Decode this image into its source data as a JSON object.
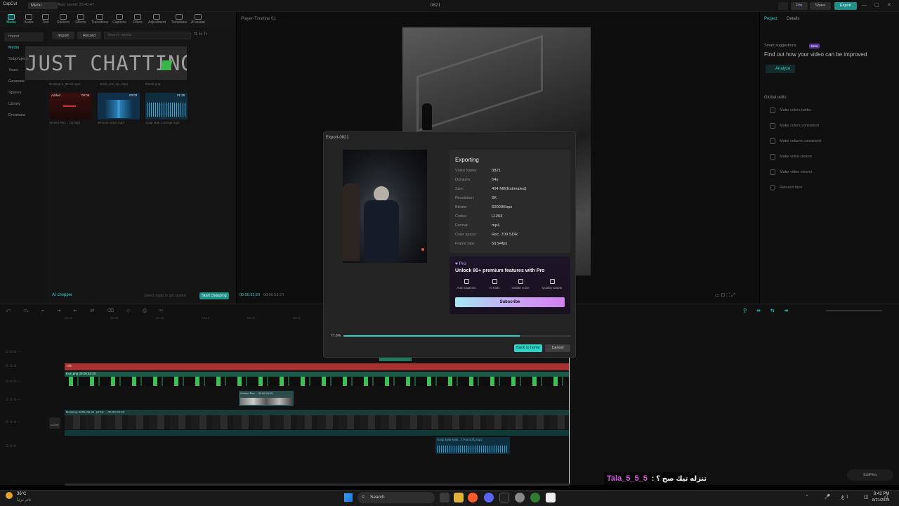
{
  "topbar": {
    "app_name": "CapCut",
    "menu_label": "Menu",
    "autosave": "Auto saved: 20:40:47",
    "window_title": "0821",
    "pro_label": "Pro",
    "share_label": "Share",
    "export_label": "Export"
  },
  "toolbar": {
    "tools": [
      "Media",
      "Audio",
      "Text",
      "Stickers",
      "Effects",
      "Transitions",
      "Captions",
      "Filters",
      "Adjustment",
      "Templates",
      "AI avatar"
    ]
  },
  "sidebar": {
    "items": [
      "Import",
      "Media",
      "Subprojects",
      "Yours",
      "Generate",
      "Spaces",
      "Library",
      "Dreamina"
    ]
  },
  "media": {
    "import_button": "Import",
    "record_button": "Record",
    "search_placeholder": "Search media",
    "overlay_text": "JUST CHATTING",
    "row1_captions": [
      "Desktop 2_08-52.mp4",
      "stock_xml_ep...mp3",
      "thumb.png"
    ],
    "row2_badges": [
      "Added",
      "00:05",
      "00:03",
      "01:35"
    ],
    "row2_captions": [
      "Screen Rec... (1).mp4",
      "Whoosh short.mp3",
      "Soap Mak-Concept.mp3"
    ],
    "ai_chopper": "AI chopper",
    "hint": "Select media to get started",
    "start_chopping": "Start chopping"
  },
  "player": {
    "title": "Player-Timeline 01",
    "current_time": "00:00:33:20",
    "total_time": "00:00:53:20"
  },
  "right_panel": {
    "tab_project": "Project",
    "tab_details": "Details",
    "smart_suggestions": "Smart suggestions",
    "smart_badge": "Beta",
    "headline": "Find out how your video can be improved",
    "analyze": "Analyze",
    "global_edits": "Global edits",
    "edits": [
      "Make colors better",
      "Make colors consistent",
      "Make volume consistent",
      "Make voice clearer",
      "Make video clearer",
      "Retouch face"
    ]
  },
  "dialog": {
    "title": "Export-0821",
    "heading": "Exporting",
    "rows": [
      {
        "label": "Video Name:",
        "value": "0821"
      },
      {
        "label": "Duration:",
        "value": "54s"
      },
      {
        "label": "Size:",
        "value": "404 MB(Estimated)"
      },
      {
        "label": "Resolution:",
        "value": "2K"
      },
      {
        "label": "Bitrate:",
        "value": "60000Kbps"
      },
      {
        "label": "Codec:",
        "value": "H.264"
      },
      {
        "label": "Format:",
        "value": "mp4"
      },
      {
        "label": "Color space:",
        "value": "Rec. 709 SDR"
      },
      {
        "label": "Frame rate:",
        "value": "59.94fps"
      }
    ],
    "pro_badge": "Pro",
    "pro_headline": "Unlock 80+ premium features with Pro",
    "features": [
      "Auto captions",
      "AI tools",
      "Isolate voice",
      "Quality assets"
    ],
    "subscribe": "Subscribe",
    "progress_text": "77.6%",
    "progress": 0.776,
    "back_home": "Back to home",
    "cancel": "Cancel"
  },
  "timeline": {
    "ruler": [
      "00:00",
      "00:05",
      "00:10",
      "00:15",
      "00:20",
      "00:25",
      "00:30",
      "00:35",
      "00:40",
      "00:45",
      "00:50"
    ],
    "clips": {
      "green_track_label": "Icon.png  00:00:53:20",
      "sticker_label": "Screen Rec... 00:00:04:20",
      "video_track_label": "Desktop 2025-08-21 18:52:... 00:00:03:20",
      "audio_label": "Soap Mak-Mak... (Yoursoft).mp3",
      "cover_label": "Cover"
    }
  },
  "overlay_chat": {
    "user": "Tala_5_5_5",
    "message": "تنزله تيك صح ؟ :"
  },
  "taskbar": {
    "weather_temp": "36°C",
    "weather_desc": "غائم جزئياً",
    "search_label": "Search",
    "time": "8:42 PM",
    "date": "8/21/2025",
    "language": "ع"
  },
  "colors": {
    "accent": "#2ed3c6",
    "pro_purple": "#b17cf0",
    "red_track": "#a83232",
    "green_track": "#1e7a5a",
    "chat_name": "#d35ce0"
  }
}
